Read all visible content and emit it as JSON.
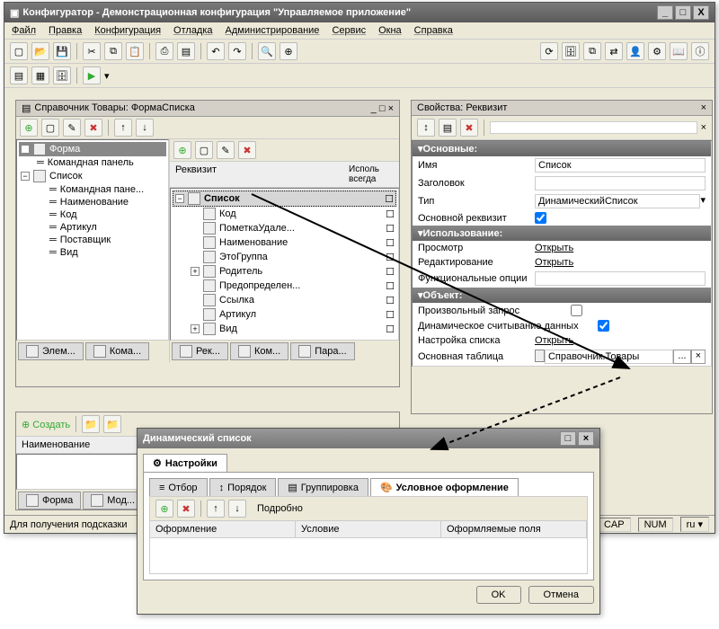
{
  "main_window": {
    "title": "Конфигуратор - Демонстрационная конфигурация \"Управляемое приложение\"",
    "titlebar_btns": {
      "min": "_",
      "max": "□",
      "close": "X"
    },
    "menu": [
      "Файл",
      "Правка",
      "Конфигурация",
      "Отладка",
      "Администрирование",
      "Сервис",
      "Окна",
      "Справка"
    ]
  },
  "form_panel": {
    "title": "Справочник Товары: ФормаСписка",
    "tree_root": "Форма",
    "tree_items": [
      "Командная панель",
      "Список",
      "Командная пане...",
      "Наименование",
      "Код",
      "Артикул",
      "Поставщик",
      "Вид"
    ],
    "requisite_header": "Реквизит",
    "requisite_col2": "Исполь\nвсегда",
    "req_items": [
      "Список",
      "Код",
      "ПометкаУдале...",
      "Наименование",
      "ЭтоГруппа",
      "Родитель",
      "Предопределен...",
      "Ссылка",
      "Артикул",
      "Вид"
    ],
    "bottom_tabs_left": [
      "Элем...",
      "Кома..."
    ],
    "bottom_tabs_right": [
      "Рек...",
      "Ком...",
      "Пара..."
    ],
    "footer_tabs": [
      "Форма",
      "Мод..."
    ]
  },
  "props_panel": {
    "title": "Свойства: Реквизит",
    "sections": {
      "main": "Основные:",
      "use": "Использование:",
      "obj": "Объект:"
    },
    "rows": {
      "name_label": "Имя",
      "name_val": "Список",
      "title_label": "Заголовок",
      "title_val": "",
      "type_label": "Тип",
      "type_val": "ДинамическийСписок",
      "main_req_label": "Основной реквизит",
      "main_req_val": true,
      "view_label": "Просмотр",
      "view_link": "Открыть",
      "edit_label": "Редактирование",
      "edit_link": "Открыть",
      "funcopt_label": "Функциональные опции",
      "custom_query_label": "Произвольный запрос",
      "custom_query_val": false,
      "dyn_read_label": "Динамическое считывание данных",
      "dyn_read_val": true,
      "list_setup_label": "Настройка списка",
      "list_setup_link": "Открыть",
      "main_table_label": "Основная таблица",
      "main_table_val": "Справочник.Товары"
    }
  },
  "lower_panel": {
    "create": "Создать",
    "col_name": "Наименование"
  },
  "dialog": {
    "title": "Динамический список",
    "setup_tab": "Настройки",
    "tabs": [
      "Отбор",
      "Порядок",
      "Группировка",
      "Условное оформление"
    ],
    "detail_btn": "Подробно",
    "grid_cols": [
      "Оформление",
      "Условие",
      "Оформляемые поля"
    ],
    "ok": "OK",
    "cancel": "Отмена"
  },
  "statusbar": {
    "hint": "Для получения подсказки",
    "cap": "CAP",
    "num": "NUM",
    "lang": "ru"
  }
}
